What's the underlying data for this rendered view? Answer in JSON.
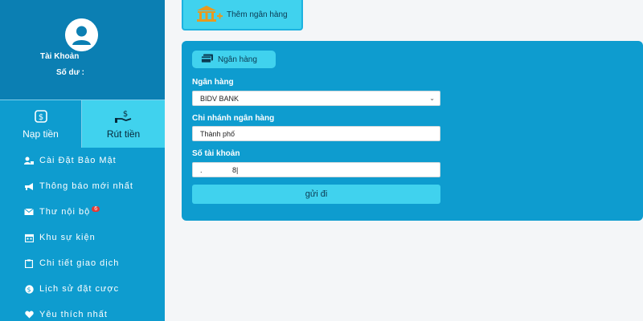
{
  "sidebar": {
    "account_label": "Tài Khoản",
    "balance_label": "Số dư :",
    "deposit_label": "Nạp tiền",
    "withdraw_label": "Rút tiền",
    "menu": [
      {
        "label": "Cài Đặt Bảo Mật",
        "icon": "user-lock-icon"
      },
      {
        "label": "Thông báo mới nhất",
        "icon": "megaphone-icon"
      },
      {
        "label": "Thư nội bộ",
        "icon": "envelope-icon",
        "badge": "6"
      },
      {
        "label": "Khu sự kiện",
        "icon": "calendar-icon"
      },
      {
        "label": "Chi tiết giao dịch",
        "icon": "clipboard-icon"
      },
      {
        "label": "Lịch sử đặt cược",
        "icon": "dollar-circle-icon"
      },
      {
        "label": "Yêu thích nhất",
        "icon": "heart-icon"
      }
    ]
  },
  "main": {
    "add_bank_label": "Thêm ngân hàng",
    "card_tab_label": "Ngân hàng",
    "bank_label": "Ngân hàng",
    "bank_value": "BIDV BANK",
    "branch_label": "Chi nhánh ngân hàng",
    "branch_value": "Thành phố",
    "account_number_label": "Số tài khoản",
    "account_number_value": ".               8|",
    "submit_label": "gửi đi"
  },
  "colors": {
    "sidebar": "#0e9ccf",
    "profile": "#0b7fb3",
    "accent": "#40d2ee",
    "badge": "#e53935"
  }
}
